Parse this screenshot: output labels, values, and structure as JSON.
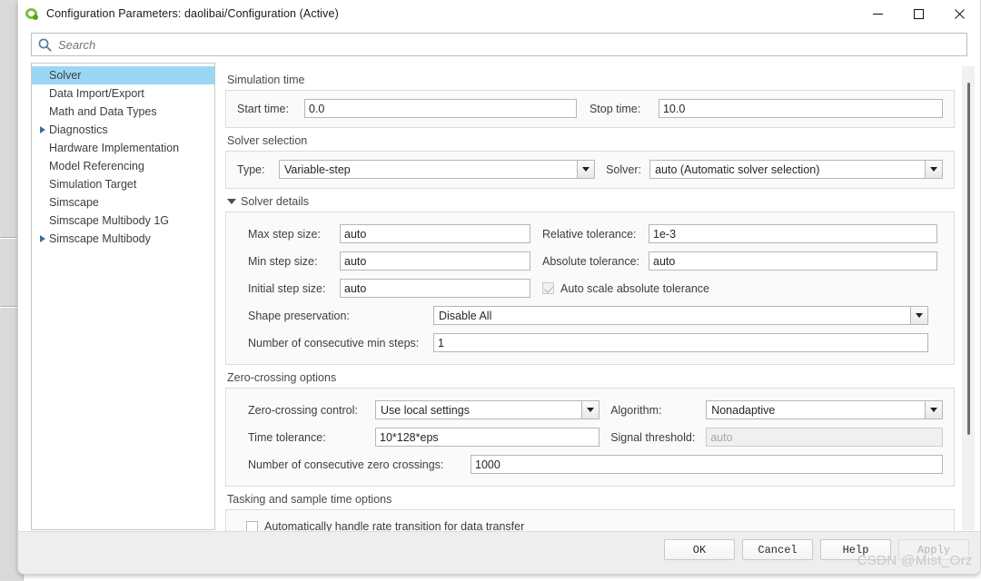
{
  "window": {
    "title": "Configuration Parameters: daolibai/Configuration (Active)",
    "app_icon": "simulink-icon",
    "minimize_icon": "minimize-icon",
    "maximize_icon": "maximize-icon",
    "close_icon": "close-icon"
  },
  "search": {
    "placeholder": "Search",
    "value": "",
    "icon": "search-icon"
  },
  "sidebar": {
    "items": [
      {
        "label": "Solver",
        "expandable": false,
        "selected": true
      },
      {
        "label": "Data Import/Export",
        "expandable": false,
        "selected": false
      },
      {
        "label": "Math and Data Types",
        "expandable": false,
        "selected": false
      },
      {
        "label": "Diagnostics",
        "expandable": true,
        "selected": false
      },
      {
        "label": "Hardware Implementation",
        "expandable": false,
        "selected": false
      },
      {
        "label": "Model Referencing",
        "expandable": false,
        "selected": false
      },
      {
        "label": "Simulation Target",
        "expandable": false,
        "selected": false
      },
      {
        "label": "Simscape",
        "expandable": false,
        "selected": false
      },
      {
        "label": "Simscape Multibody 1G",
        "expandable": false,
        "selected": false
      },
      {
        "label": "Simscape Multibody",
        "expandable": true,
        "selected": false
      }
    ]
  },
  "simulation_time": {
    "section_label": "Simulation time",
    "start_time_label": "Start time:",
    "start_time_value": "0.0",
    "stop_time_label": "Stop time:",
    "stop_time_value": "10.0"
  },
  "solver_selection": {
    "section_label": "Solver selection",
    "type_label": "Type:",
    "type_value": "Variable-step",
    "solver_label": "Solver:",
    "solver_value": "auto (Automatic solver selection)"
  },
  "solver_details": {
    "section_label": "Solver details",
    "expanded": true,
    "max_step_size_label": "Max step size:",
    "max_step_size_value": "auto",
    "relative_tolerance_label": "Relative tolerance:",
    "relative_tolerance_value": "1e-3",
    "min_step_size_label": "Min step size:",
    "min_step_size_value": "auto",
    "absolute_tolerance_label": "Absolute tolerance:",
    "absolute_tolerance_value": "auto",
    "initial_step_size_label": "Initial step size:",
    "initial_step_size_value": "auto",
    "auto_scale_abs_tol_label": "Auto scale absolute tolerance",
    "auto_scale_abs_tol_checked": true,
    "auto_scale_abs_tol_enabled": false,
    "shape_preservation_label": "Shape preservation:",
    "shape_preservation_value": "Disable All",
    "consecutive_min_steps_label": "Number of consecutive min steps:",
    "consecutive_min_steps_value": "1"
  },
  "zero_crossing": {
    "section_label": "Zero-crossing options",
    "control_label": "Zero-crossing control:",
    "control_value": "Use local settings",
    "algorithm_label": "Algorithm:",
    "algorithm_value": "Nonadaptive",
    "time_tolerance_label": "Time tolerance:",
    "time_tolerance_value": "10*128*eps",
    "signal_threshold_label": "Signal threshold:",
    "signal_threshold_value": "auto",
    "signal_threshold_enabled": false,
    "consecutive_zero_crossings_label": "Number of consecutive zero crossings:",
    "consecutive_zero_crossings_value": "1000"
  },
  "tasking": {
    "section_label": "Tasking and sample time options",
    "auto_rate_transition_label": "Automatically handle rate transition for data transfer",
    "auto_rate_transition_checked": false
  },
  "footer": {
    "ok_label": "OK",
    "cancel_label": "Cancel",
    "help_label": "Help",
    "apply_label": "Apply",
    "apply_enabled": false
  },
  "watermark": {
    "text": "CSDN @Mist_Orz"
  }
}
